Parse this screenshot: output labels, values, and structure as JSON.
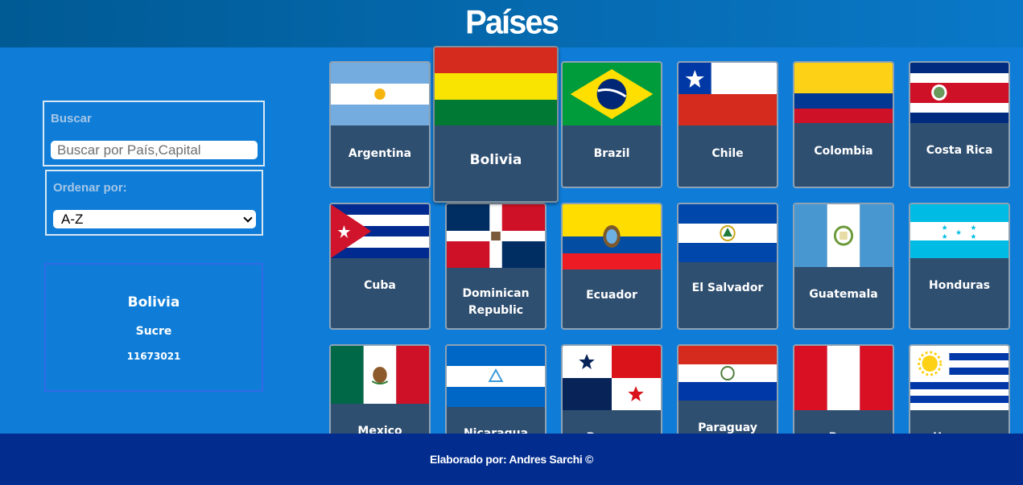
{
  "header": {
    "title": "Países"
  },
  "search": {
    "label": "Buscar",
    "placeholder": "Buscar por País,Capital"
  },
  "order": {
    "label": "Ordenar por:",
    "selected": "A-Z"
  },
  "detail": {
    "name": "Bolivia",
    "capital": "Sucre",
    "population": "11673021"
  },
  "countries": [
    "Argentina",
    "Bolivia",
    "Brazil",
    "Chile",
    "Colombia",
    "Costa Rica",
    "Cuba",
    "Dominican Republic",
    "Ecuador",
    "El Salvador",
    "Guatemala",
    "Honduras",
    "Mexico",
    "Nicaragua",
    "Panama",
    "Paraguay",
    "Peru",
    "Uruguay"
  ],
  "footer": {
    "prefix": "Elaborado por:",
    "author": "Andres Sarchi",
    "mark": "©"
  },
  "colors": {
    "header": "#005a94",
    "background": "#0f7dd8",
    "card": "#2f4f70",
    "footer": "#022d8f",
    "detail_border": "#3169e6"
  }
}
